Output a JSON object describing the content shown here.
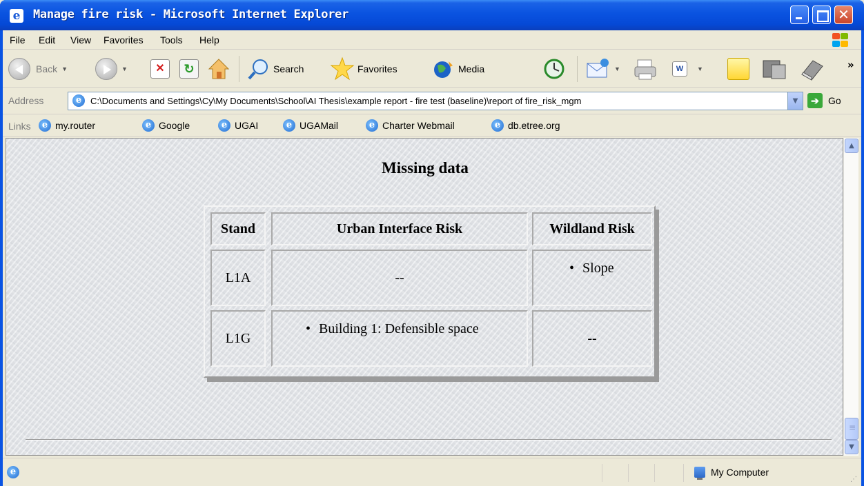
{
  "window": {
    "title": "Manage fire risk - Microsoft Internet Explorer",
    "icon": "ie-icon"
  },
  "menu": {
    "items": [
      "File",
      "Edit",
      "View",
      "Favorites",
      "Tools",
      "Help"
    ]
  },
  "toolbar": {
    "back_label": "Back",
    "search_label": "Search",
    "favorites_label": "Favorites",
    "media_label": "Media",
    "overflow_label": "»"
  },
  "address": {
    "label": "Address",
    "value": "C:\\Documents and Settings\\Cy\\My Documents\\School\\AI Thesis\\example report - fire test (baseline)\\report of fire_risk_mgm",
    "go_label": "Go"
  },
  "links": {
    "label": "Links",
    "items": [
      "my.router",
      "Google",
      "UGAI",
      "UGAMail",
      "Charter Webmail",
      "db.etree.org"
    ]
  },
  "page": {
    "heading": "Missing data",
    "table": {
      "headers": [
        "Stand",
        "Urban Interface Risk",
        "Wildland Risk"
      ],
      "rows": [
        {
          "stand": "L1A",
          "urban": "--",
          "wildland": "Slope"
        },
        {
          "stand": "L1G",
          "urban": "Building 1: Defensible space",
          "wildland": "--"
        }
      ]
    }
  },
  "status": {
    "zone": "My Computer"
  },
  "colors": {
    "titlebar": "#0a53e0",
    "chrome": "#ece9d8"
  }
}
